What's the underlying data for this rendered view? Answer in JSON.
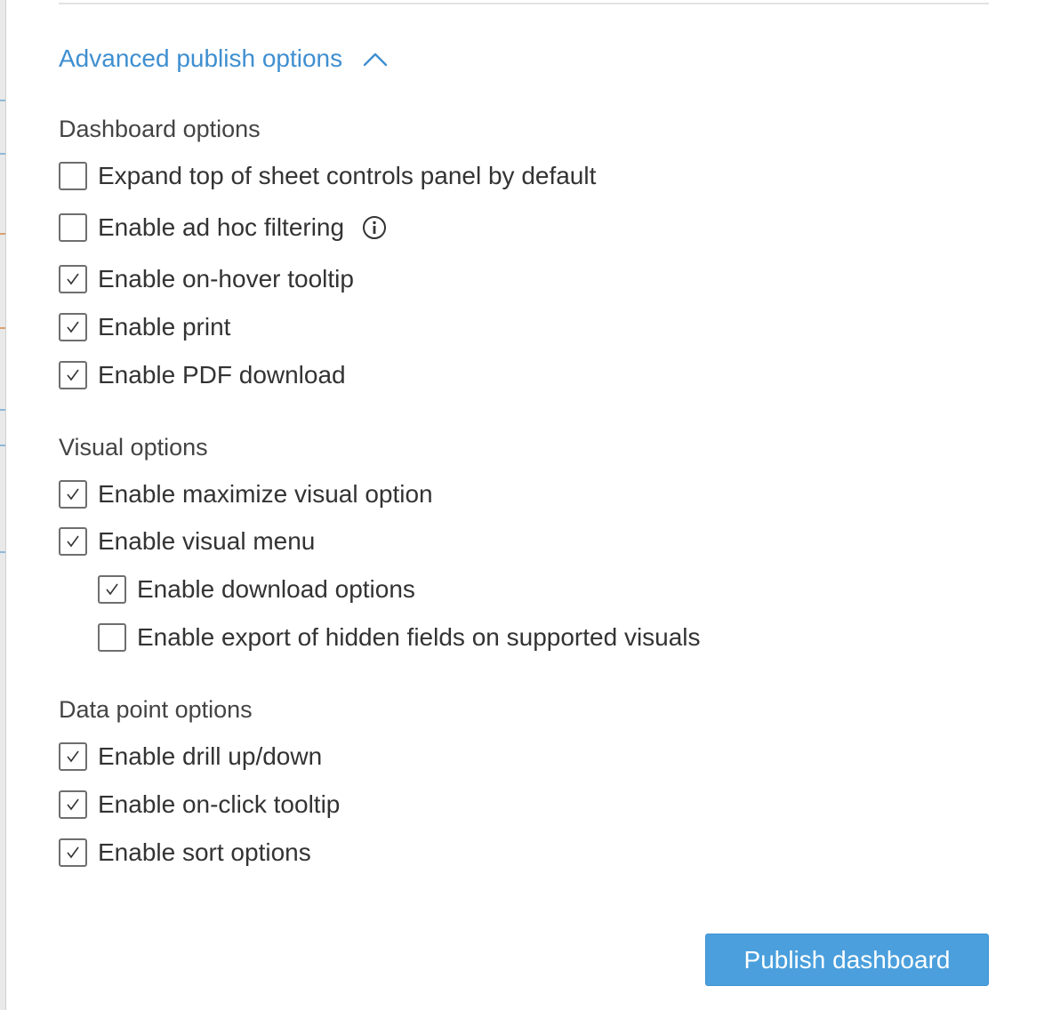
{
  "panel": {
    "toggle_label": "Advanced publish options",
    "toggle_icon": "chevron-up-icon",
    "accent_color": "#3f8fd0"
  },
  "sections": {
    "dashboard": {
      "heading": "Dashboard options",
      "items": [
        {
          "label": "Expand top of sheet controls panel by default",
          "checked": false
        },
        {
          "label": "Enable ad hoc filtering",
          "checked": false,
          "icon": "info-icon"
        },
        {
          "label": "Enable on-hover tooltip",
          "checked": true
        },
        {
          "label": "Enable print",
          "checked": true
        },
        {
          "label": "Enable PDF download",
          "checked": true
        }
      ]
    },
    "visual": {
      "heading": "Visual options",
      "items": [
        {
          "label": "Enable maximize visual option",
          "checked": true
        },
        {
          "label": "Enable visual menu",
          "checked": true
        },
        {
          "label": "Enable download options",
          "checked": true,
          "nested": true
        },
        {
          "label": "Enable export of hidden fields on supported visuals",
          "checked": false,
          "nested": true
        }
      ]
    },
    "datapoint": {
      "heading": "Data point options",
      "items": [
        {
          "label": "Enable drill up/down",
          "checked": true
        },
        {
          "label": "Enable on-click tooltip",
          "checked": true
        },
        {
          "label": "Enable sort options",
          "checked": true
        }
      ]
    }
  },
  "footer": {
    "publish_label": "Publish dashboard",
    "publish_color": "#4a9fdc"
  }
}
